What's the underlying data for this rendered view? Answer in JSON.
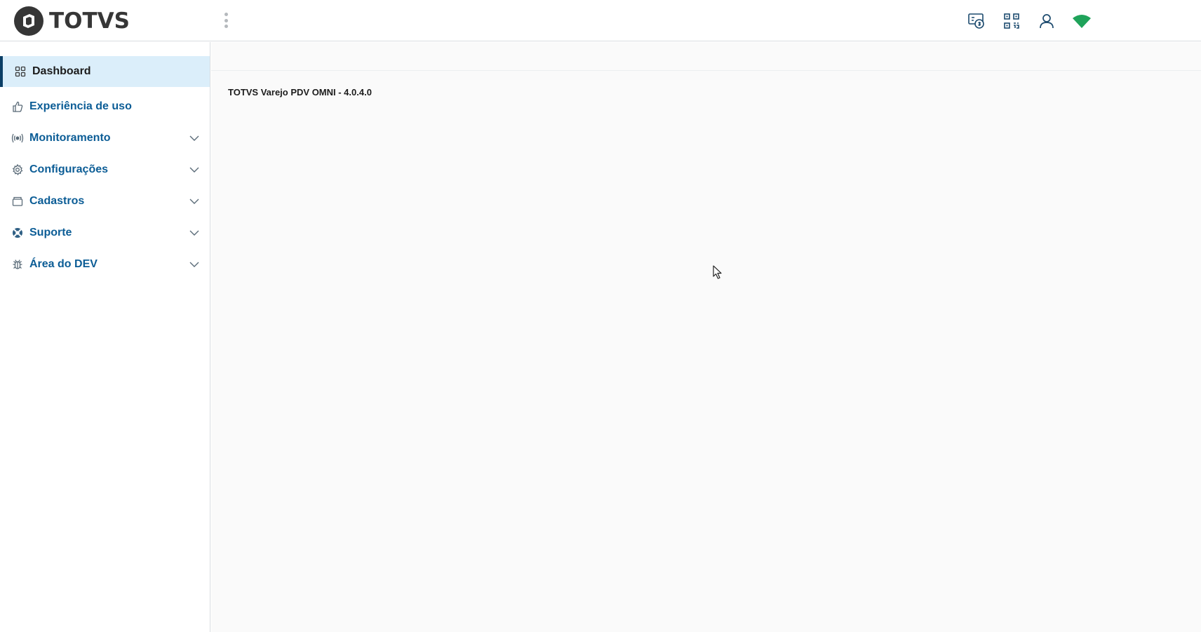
{
  "brand": {
    "name": "TOTVS"
  },
  "header": {
    "actions": [
      {
        "name": "cash-register-icon"
      },
      {
        "name": "qr-code-icon"
      },
      {
        "name": "user-icon"
      },
      {
        "name": "wifi-icon"
      }
    ]
  },
  "sidebar": {
    "items": [
      {
        "label": "Dashboard",
        "icon": "grid-icon",
        "active": true,
        "expandable": false
      },
      {
        "label": "Experiência de uso",
        "icon": "thumbs-up-icon",
        "expandable": false
      },
      {
        "label": "Monitoramento",
        "icon": "broadcast-icon",
        "expandable": true
      },
      {
        "label": "Configurações",
        "icon": "gear-icon",
        "expandable": true
      },
      {
        "label": "Cadastros",
        "icon": "folder-icon",
        "expandable": true
      },
      {
        "label": "Suporte",
        "icon": "lifebuoy-icon",
        "expandable": true
      },
      {
        "label": "Área do DEV",
        "icon": "bug-icon",
        "expandable": true
      }
    ]
  },
  "main": {
    "version_text": "TOTVS Varejo PDV OMNI - 4.0.4.0"
  },
  "colors": {
    "accent": "#0c5d96",
    "active_bg": "#dbeefa",
    "active_border": "#0c3f66",
    "wifi": "#1fa35a"
  }
}
